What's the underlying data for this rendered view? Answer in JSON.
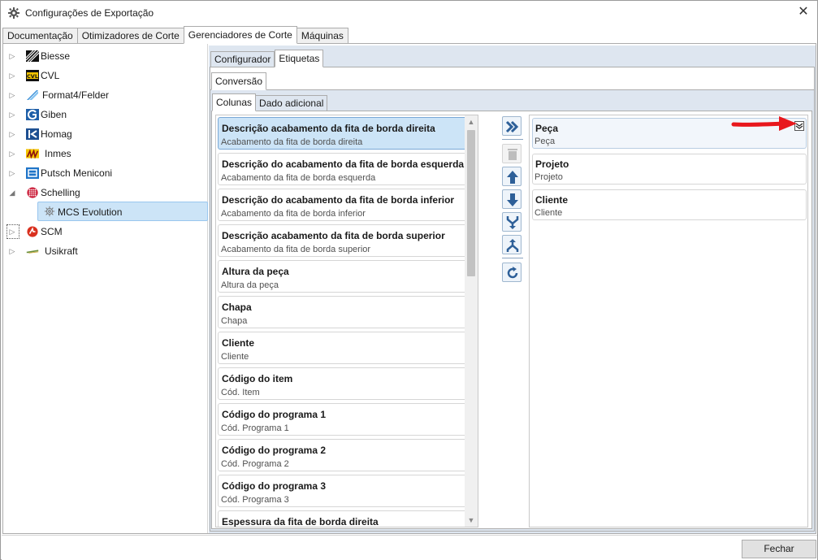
{
  "window": {
    "title": "Configurações de Exportação",
    "close_glyph": "✕"
  },
  "main_tabs": [
    "Documentação",
    "Otimizadores de Corte",
    "Gerenciadores de Corte",
    "Máquinas"
  ],
  "tree": {
    "items": [
      {
        "label": "Biesse",
        "expander": "▷",
        "icon": "biesse-logo-icon"
      },
      {
        "label": "CVL",
        "expander": "▷",
        "icon": "cvl-logo-icon"
      },
      {
        "label": "Format4/Felder",
        "expander": "▷",
        "icon": "format4-logo-icon"
      },
      {
        "label": "Giben",
        "expander": "▷",
        "icon": "giben-logo-icon"
      },
      {
        "label": "Homag",
        "expander": "▷",
        "icon": "homag-logo-icon"
      },
      {
        "label": "Inmes",
        "expander": "▷",
        "icon": "inmes-logo-icon"
      },
      {
        "label": "Putsch Meniconi",
        "expander": "▷",
        "icon": "putsch-logo-icon"
      },
      {
        "label": "Schelling",
        "expander": "◢",
        "icon": "schelling-logo-icon"
      },
      {
        "label": "SCM",
        "expander": "▷",
        "icon": "scm-logo-icon"
      },
      {
        "label": "Usikraft",
        "expander": "▷",
        "icon": "usikraft-logo-icon"
      }
    ],
    "child": {
      "label": "MCS Evolution",
      "icon": "gear-icon"
    }
  },
  "sub_tabs": [
    "Configurador",
    "Etiquetas"
  ],
  "conversion_tab": "Conversão",
  "column_tabs": [
    "Colunas",
    "Dado adicional"
  ],
  "available_columns": [
    {
      "title": "Descrição acabamento da fita de borda direita",
      "sub": "Acabamento da fita de borda direita"
    },
    {
      "title": "Descrição do acabamento da fita de borda esquerda",
      "sub": "Acabamento da fita de borda esquerda"
    },
    {
      "title": "Descrição do acabamento da fita de borda inferior",
      "sub": "Acabamento da fita de borda inferior"
    },
    {
      "title": "Descrição acabamento da fita de borda superior",
      "sub": "Acabamento da fita de borda superior"
    },
    {
      "title": "Altura da peça",
      "sub": "Altura da peça"
    },
    {
      "title": "Chapa",
      "sub": "Chapa"
    },
    {
      "title": "Cliente",
      "sub": "Cliente"
    },
    {
      "title": "Código do item",
      "sub": "Cód. Item"
    },
    {
      "title": "Código do programa 1",
      "sub": "Cód. Programa 1"
    },
    {
      "title": "Código do programa 2",
      "sub": "Cód. Programa 2"
    },
    {
      "title": "Código do programa 3",
      "sub": "Cód. Programa 3"
    },
    {
      "title": "Espessura da fita de borda direita",
      "sub": ""
    }
  ],
  "selected_columns": [
    {
      "title": "Peça",
      "sub": "Peça"
    },
    {
      "title": "Projeto",
      "sub": "Projeto"
    },
    {
      "title": "Cliente",
      "sub": "Cliente"
    }
  ],
  "tools": [
    "add-all-icon",
    "delete-icon",
    "move-up-icon",
    "move-down-icon",
    "merge-icon",
    "split-icon",
    "refresh-icon"
  ],
  "footer": {
    "close_label": "Fechar"
  },
  "colors": {
    "selection": "#cce4f7",
    "panel_bg": "#dee6f0",
    "arrow": "#e8171c",
    "tool_blue": "#2d5f98"
  }
}
